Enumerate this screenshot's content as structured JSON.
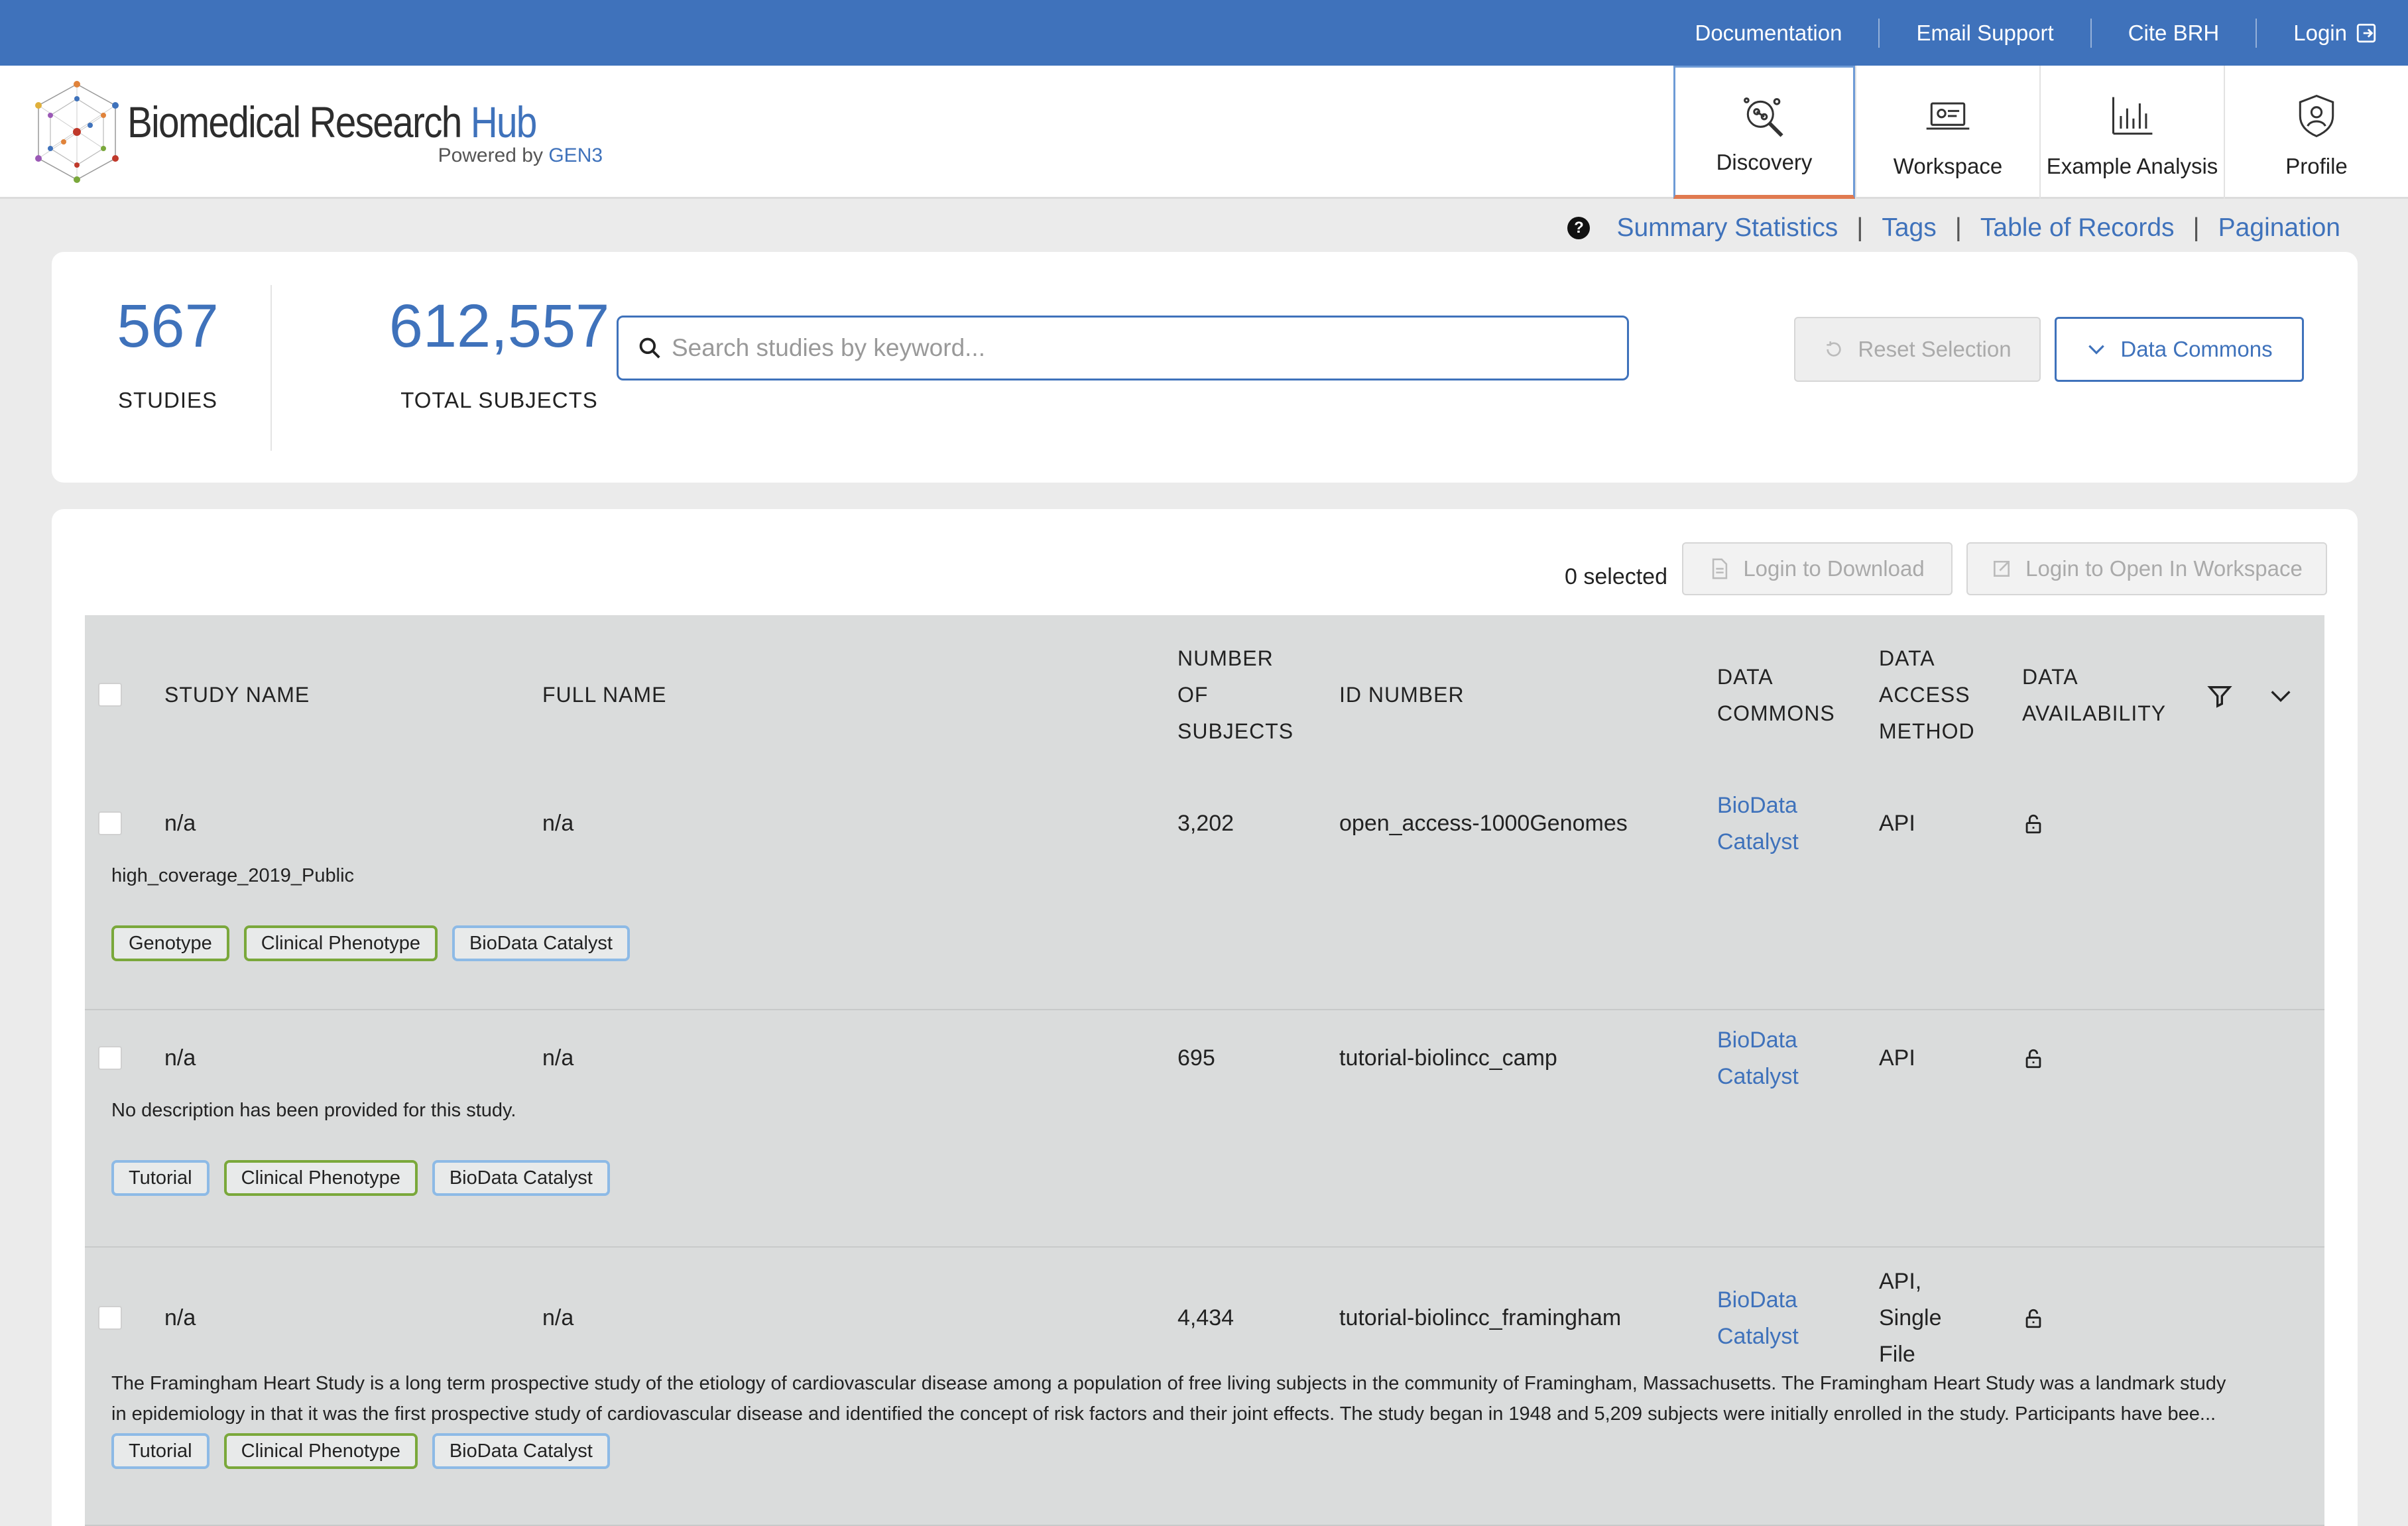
{
  "topbar": {
    "links": [
      "Documentation",
      "Email Support",
      "Cite BRH",
      "Login"
    ]
  },
  "logo": {
    "title_main": "Biomedical Research",
    "title_hub": "Hub",
    "powered_prefix": "Powered by",
    "powered_brand": "GEN3"
  },
  "nav": {
    "tabs": [
      {
        "label": "Discovery",
        "icon": "discovery-icon",
        "active": true
      },
      {
        "label": "Workspace",
        "icon": "workspace-icon"
      },
      {
        "label": "Example Analysis",
        "icon": "analysis-chart-icon"
      },
      {
        "label": "Profile",
        "icon": "profile-shield-icon"
      }
    ]
  },
  "links": {
    "help": "?",
    "items": [
      "Summary Statistics",
      "Tags",
      "Table of Records",
      "Pagination"
    ],
    "sep": "|"
  },
  "stats": {
    "studies_value": "567",
    "studies_label": "STUDIES",
    "subjects_value": "612,557",
    "subjects_label": "TOTAL SUBJECTS"
  },
  "search": {
    "placeholder": "Search studies by keyword..."
  },
  "buttons": {
    "reset": "Reset Selection",
    "data_commons": "Data Commons",
    "selected": "0 selected",
    "download": "Login to Download",
    "open_workspace": "Login to Open In Workspace"
  },
  "table": {
    "headers": {
      "study_name": "STUDY NAME",
      "full_name": "FULL NAME",
      "num_subjects_1": "NUMBER",
      "num_subjects_2": "OF",
      "num_subjects_3": "SUBJECTS",
      "id_number": "ID NUMBER",
      "data_commons_1": "DATA",
      "data_commons_2": "COMMONS",
      "access_1": "DATA",
      "access_2": "ACCESS",
      "access_3": "METHOD",
      "availability_1": "DATA",
      "availability_2": "AVAILABILITY"
    },
    "rows": [
      {
        "study_name": "n/a",
        "full_name": "n/a",
        "subjects": "3,202",
        "id": "open_access-1000Genomes",
        "commons_1": "BioData",
        "commons_2": "Catalyst",
        "access_1": "API",
        "access_2": "",
        "access_3": "",
        "description": "high_coverage_2019_Public",
        "tags": [
          {
            "label": "Genotype",
            "color": "green"
          },
          {
            "label": "Clinical Phenotype",
            "color": "green"
          },
          {
            "label": "BioData Catalyst",
            "color": "blue"
          }
        ]
      },
      {
        "study_name": "n/a",
        "full_name": "n/a",
        "subjects": "695",
        "id": "tutorial-biolincc_camp",
        "commons_1": "BioData",
        "commons_2": "Catalyst",
        "access_1": "API",
        "access_2": "",
        "access_3": "",
        "description": "No description has been provided for this study.",
        "tags": [
          {
            "label": "Tutorial",
            "color": "blue"
          },
          {
            "label": "Clinical Phenotype",
            "color": "green"
          },
          {
            "label": "BioData Catalyst",
            "color": "blue"
          }
        ]
      },
      {
        "study_name": "n/a",
        "full_name": "n/a",
        "subjects": "4,434",
        "id": "tutorial-biolincc_framingham",
        "commons_1": "BioData",
        "commons_2": "Catalyst",
        "access_1": "API,",
        "access_2": "Single",
        "access_3": "File",
        "description_1": "The Framingham Heart Study is a long term prospective study of the etiology of cardiovascular disease among a population of free living subjects in the community of Framingham, Massachusetts. The Framingham Heart Study was a landmark study",
        "description_2": "in epidemiology in that it was the first prospective study of cardiovascular disease and identified the concept of risk factors and their joint effects. The study began in 1948 and 5,209 subjects were initially enrolled in the study. Participants have bee...",
        "tags": [
          {
            "label": "Tutorial",
            "color": "blue"
          },
          {
            "label": "Clinical Phenotype",
            "color": "green"
          },
          {
            "label": "BioData Catalyst",
            "color": "blue"
          }
        ]
      }
    ]
  },
  "colors": {
    "brand_blue": "#3f72bb",
    "tag_green": "#7aa83b",
    "tag_blue": "#8dbae6",
    "active_tab_underline": "#e07a50"
  }
}
